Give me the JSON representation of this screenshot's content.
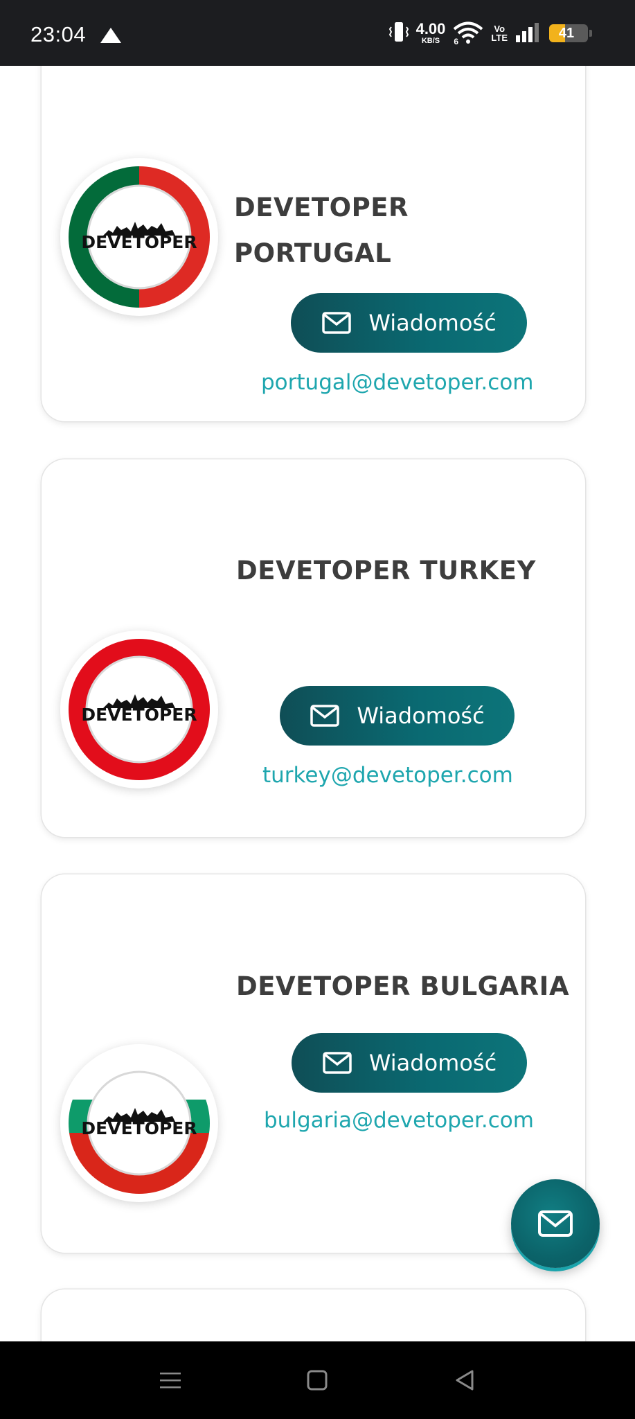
{
  "status_bar": {
    "time": "23:04",
    "net_speed_value": "4.00",
    "net_speed_unit": "KB/S",
    "network_generation": "6",
    "volte_top": "Vo",
    "volte_bottom": "LTE",
    "battery_level": "41"
  },
  "contacts": [
    {
      "title": "DEVETOPER PORTUGAL",
      "button_label": "Wiadomość",
      "email": "portugal@devetoper.com",
      "logo_text": "DEVETOPER",
      "ring_colors": [
        "#036b3a",
        "#de2a24"
      ]
    },
    {
      "title": "DEVETOPER TURKEY",
      "button_label": "Wiadomość",
      "email": "turkey@devetoper.com",
      "logo_text": "DEVETOPER",
      "ring_colors": [
        "#e20d1b"
      ]
    },
    {
      "title": "DEVETOPER BULGARIA",
      "button_label": "Wiadomość",
      "email": "bulgaria@devetoper.com",
      "logo_text": "DEVETOPER",
      "ring_colors": [
        "#ffffff",
        "#0e9b6a",
        "#d9261a"
      ]
    }
  ],
  "colors": {
    "button_gradient_start": "#0f4e56",
    "button_gradient_end": "#0d7479",
    "email_text": "#1ea6ae",
    "title_text": "#3d3d3d"
  },
  "icons": {
    "message": "envelope-icon",
    "fab": "envelope-icon",
    "nav": [
      "menu-icon",
      "home-square-icon",
      "back-triangle-icon"
    ]
  }
}
